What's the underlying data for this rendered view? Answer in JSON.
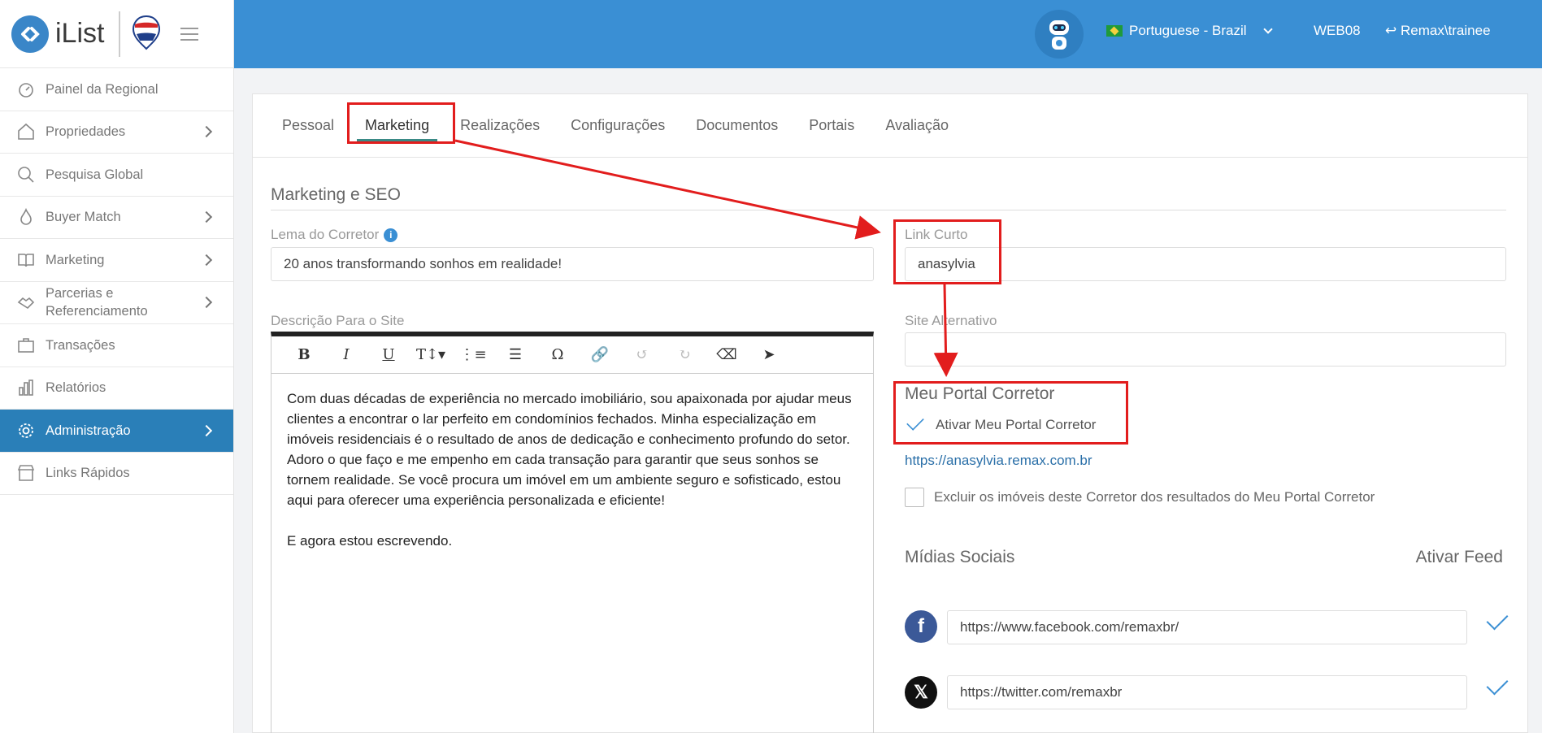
{
  "app": {
    "logo_text": "iList",
    "brand": "RE/MAX"
  },
  "topbar": {
    "language": "Portuguese - Brazil",
    "office": "WEB08",
    "user": "Remax\\trainee"
  },
  "sidebar": {
    "items": [
      {
        "label": "Painel da Regional",
        "icon": "dashboard-icon",
        "chevron": false
      },
      {
        "label": "Propriedades",
        "icon": "home-icon",
        "chevron": true
      },
      {
        "label": "Pesquisa Global",
        "icon": "search-icon",
        "chevron": false
      },
      {
        "label": "Buyer Match",
        "icon": "flame-icon",
        "chevron": true
      },
      {
        "label": "Marketing",
        "icon": "book-icon",
        "chevron": true
      },
      {
        "label": "Parcerias e Referenciamento",
        "icon": "handshake-icon",
        "chevron": true
      },
      {
        "label": "Transações",
        "icon": "briefcase-icon",
        "chevron": false
      },
      {
        "label": "Relatórios",
        "icon": "bar-chart-icon",
        "chevron": false
      },
      {
        "label": "Administração",
        "icon": "gear-icon",
        "chevron": true,
        "active": true
      },
      {
        "label": "Links Rápidos",
        "icon": "store-icon",
        "chevron": false
      }
    ]
  },
  "tabs": [
    "Pessoal",
    "Marketing",
    "Realizações",
    "Configurações",
    "Documentos",
    "Portais",
    "Avaliação"
  ],
  "active_tab": "Marketing",
  "form": {
    "section_title": "Marketing e SEO",
    "lema_label": "Lema do Corretor",
    "lema_value": "20 anos transformando sonhos em realidade!",
    "link_label": "Link Curto",
    "link_value": "anasylvia",
    "descricao_label": "Descrição Para o Site",
    "site_label": "Site Alternativo",
    "site_value": "",
    "description_p1": "Com duas décadas de experiência no mercado imobiliário, sou apaixonada por ajudar meus clientes a encontrar o lar perfeito em condomínios fechados. Minha especialização em imóveis residenciais é o resultado de anos de dedicação e conhecimento profundo do setor. Adoro o que faço e me empenho em cada transação para garantir que seus sonhos se tornem realidade. Se você procura um imóvel em um ambiente seguro e sofisticado, estou aqui para oferecer uma experiência personalizada e eficiente!",
    "description_p2": "E agora estou escrevendo.",
    "portal_title": "Meu Portal Corretor",
    "portal_checkbox_label": "Ativar Meu Portal Corretor",
    "portal_checked": true,
    "portal_url": "https://anasylvia.remax.com.br",
    "exclude_label": "Excluir os imóveis deste Corretor dos resultados do Meu Portal Corretor",
    "exclude_checked": false,
    "social_title": "Mídias Sociais",
    "feed_title": "Ativar Feed",
    "social": [
      {
        "network": "facebook",
        "icon_text": "f",
        "url": "https://www.facebook.com/remaxbr/",
        "feed": true
      },
      {
        "network": "x",
        "icon_text": "𝕏",
        "url": "https://twitter.com/remaxbr",
        "feed": true
      }
    ]
  },
  "toolbar": {
    "bold": "B",
    "italic": "I",
    "underline": "U",
    "font_size": "T↕▾",
    "ordered_list": "⋮≡",
    "bullet_list": "☰",
    "special_char": "Ω",
    "link": "🔗",
    "undo": "↺",
    "redo": "↻",
    "eraser": "⌫",
    "pointer": "➤"
  },
  "colors": {
    "topbar": "#3a8fd4",
    "sidebar_active": "#2a7fb8",
    "annotation_red": "#e21d1d",
    "tab_underline": "#3a8a86"
  }
}
